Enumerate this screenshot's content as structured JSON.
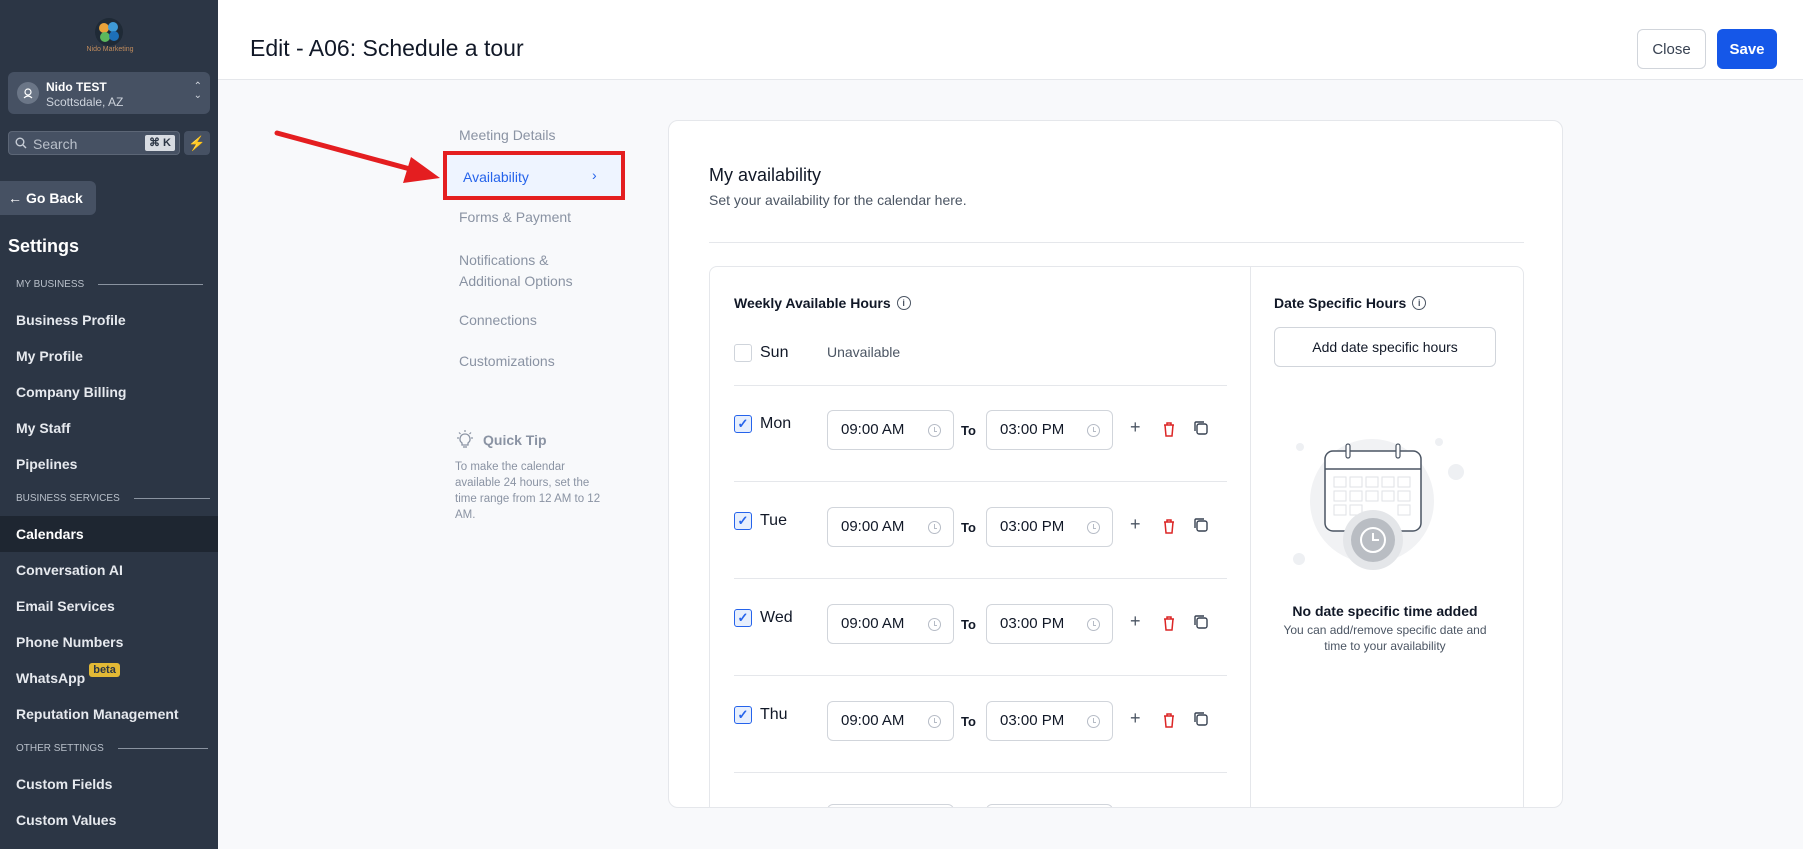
{
  "sidebar": {
    "logo_caption": "Nido Marketing",
    "location": {
      "name": "Nido TEST",
      "city": "Scottsdale, AZ"
    },
    "search_placeholder": "Search",
    "search_shortcut": "⌘ K",
    "go_back": "Go Back",
    "settings_title": "Settings",
    "sections": {
      "my_business": "MY BUSINESS",
      "business_services": "BUSINESS SERVICES",
      "other_settings": "OTHER SETTINGS"
    },
    "items": [
      "Business Profile",
      "My Profile",
      "Company Billing",
      "My Staff",
      "Pipelines",
      "Calendars",
      "Conversation AI",
      "Email Services",
      "Phone Numbers",
      "WhatsApp",
      "Reputation Management",
      "Custom Fields",
      "Custom Values"
    ],
    "beta_badge": "beta",
    "active_item": "Calendars"
  },
  "header": {
    "title": "Edit - A06: Schedule a tour",
    "close_label": "Close",
    "save_label": "Save"
  },
  "tabs": {
    "meeting_details": "Meeting Details",
    "availability": "Availability",
    "forms_payment": "Forms & Payment",
    "notifications_line1": "Notifications &",
    "notifications_line2": "Additional Options",
    "connections": "Connections",
    "customizations": "Customizations",
    "active": "Availability"
  },
  "quick_tip": {
    "title": "Quick Tip",
    "text": "To make the calendar available 24 hours, set the time range from 12 AM to 12 AM."
  },
  "availability": {
    "title": "My availability",
    "subtitle": "Set your availability for the calendar here.",
    "weekly_title": "Weekly Available Hours",
    "date_specific_title": "Date Specific Hours",
    "add_date_specific": "Add date specific hours",
    "empty_title": "No date specific time added",
    "empty_text": "You can add/remove specific date and time to your availability",
    "to_label": "To",
    "days": [
      {
        "label": "Sun",
        "checked": false,
        "status": "Unavailable"
      },
      {
        "label": "Mon",
        "checked": true,
        "start": "09:00 AM",
        "end": "03:00 PM"
      },
      {
        "label": "Tue",
        "checked": true,
        "start": "09:00 AM",
        "end": "03:00 PM"
      },
      {
        "label": "Wed",
        "checked": true,
        "start": "09:00 AM",
        "end": "03:00 PM"
      },
      {
        "label": "Thu",
        "checked": true,
        "start": "09:00 AM",
        "end": "03:00 PM"
      }
    ]
  },
  "colors": {
    "sidebar_bg": "#2c3645",
    "primary": "#1557e8",
    "highlight_red": "#e41e20",
    "delete_red": "#dc2626"
  }
}
